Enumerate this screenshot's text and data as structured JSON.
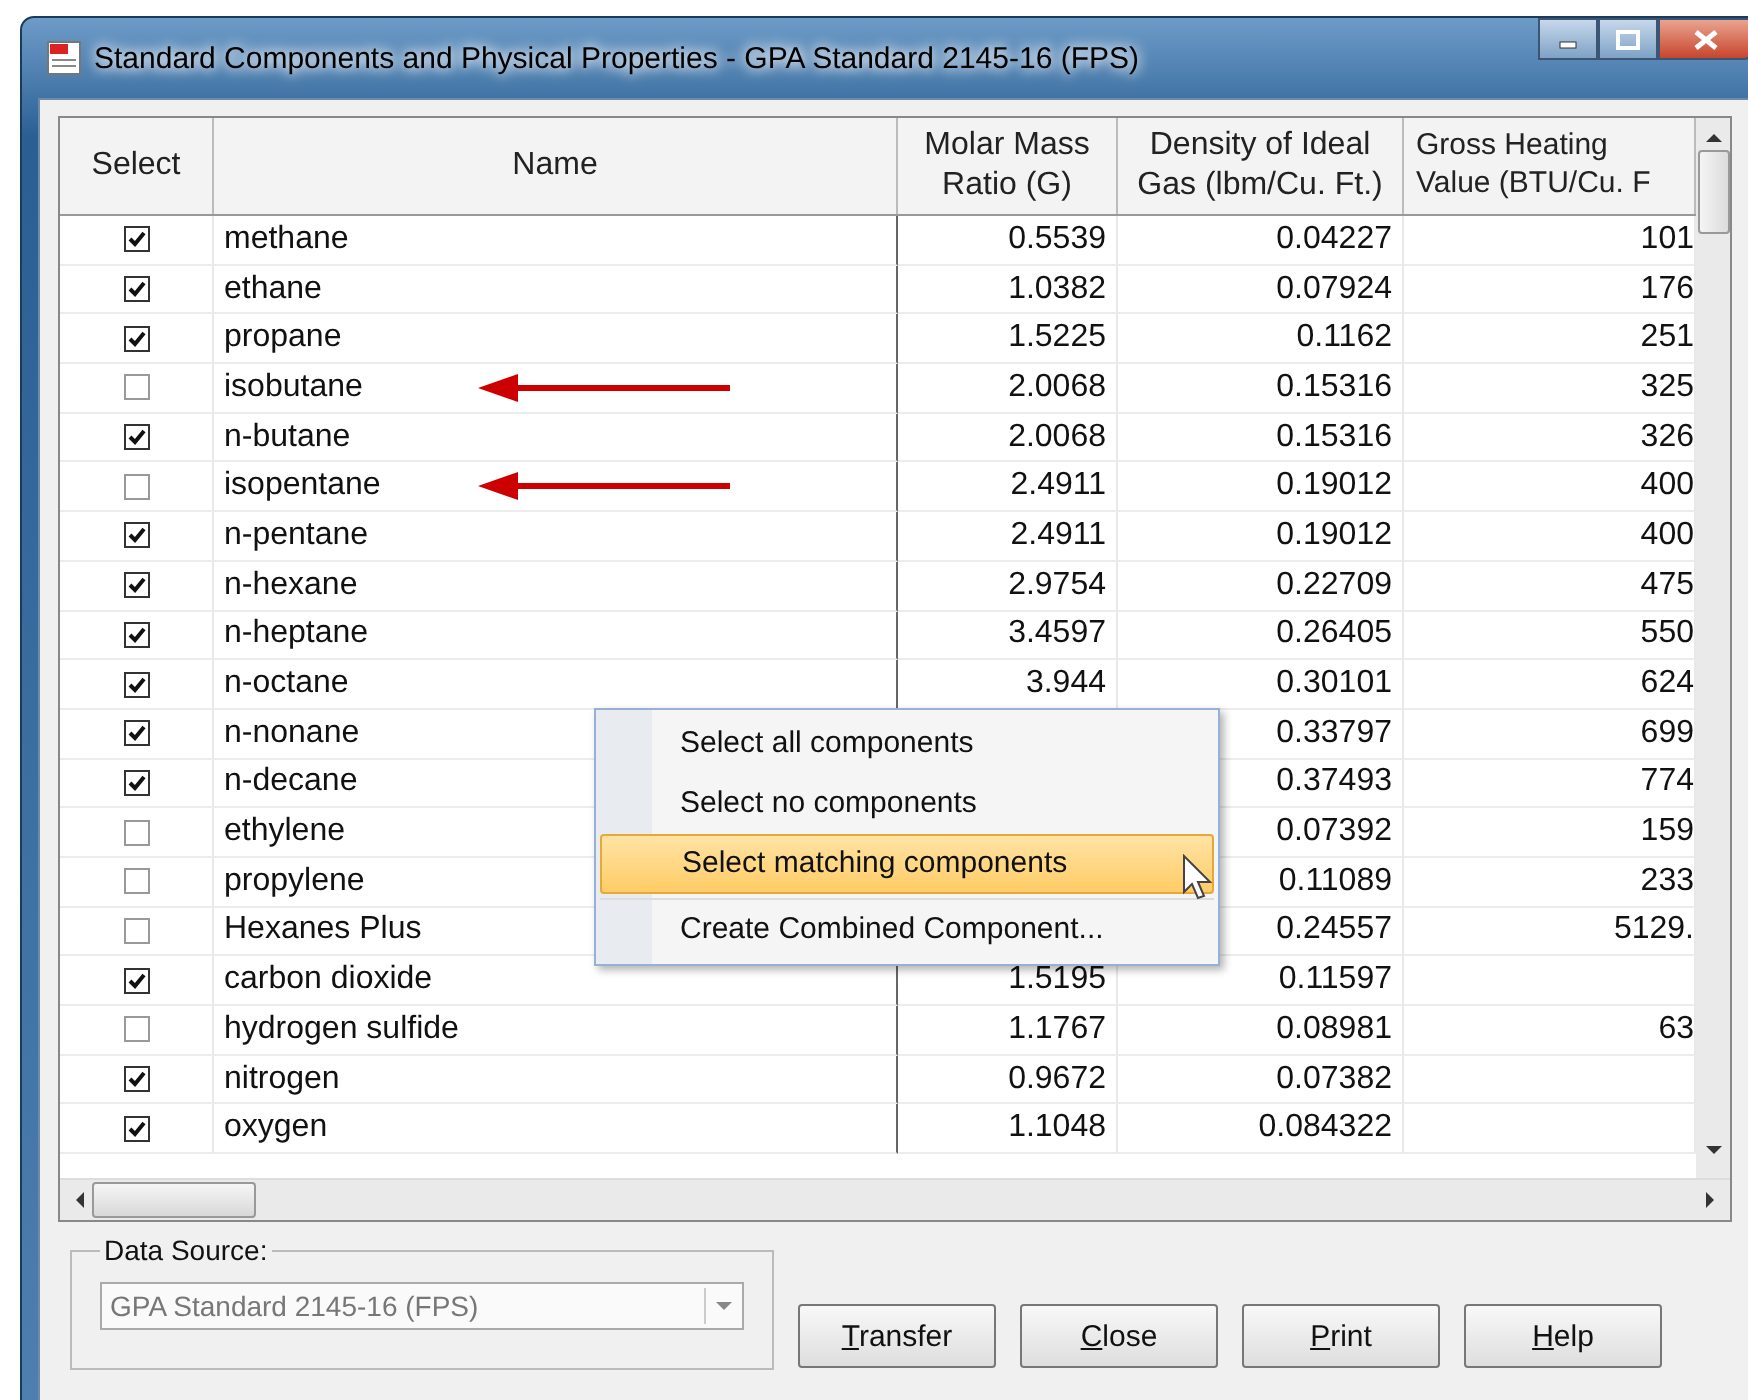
{
  "window": {
    "title": "Standard Components and Physical Properties - GPA Standard 2145-16 (FPS)"
  },
  "table": {
    "columns": [
      "Select",
      "Name",
      "Molar Mass Ratio (G)",
      "Density of Ideal Gas (lbm/Cu. Ft.)",
      "Gross Heating Value (BTU/Cu. F"
    ],
    "rows": [
      {
        "checked": true,
        "annotated": false,
        "name": "methane",
        "molar": "0.5539",
        "density": "0.04227",
        "heating": "101"
      },
      {
        "checked": true,
        "annotated": false,
        "name": "ethane",
        "molar": "1.0382",
        "density": "0.07924",
        "heating": "176"
      },
      {
        "checked": true,
        "annotated": false,
        "name": "propane",
        "molar": "1.5225",
        "density": "0.1162",
        "heating": "251"
      },
      {
        "checked": false,
        "annotated": true,
        "name": "isobutane",
        "molar": "2.0068",
        "density": "0.15316",
        "heating": "325"
      },
      {
        "checked": true,
        "annotated": false,
        "name": "n-butane",
        "molar": "2.0068",
        "density": "0.15316",
        "heating": "326"
      },
      {
        "checked": false,
        "annotated": true,
        "name": "isopentane",
        "molar": "2.4911",
        "density": "0.19012",
        "heating": "400"
      },
      {
        "checked": true,
        "annotated": false,
        "name": "n-pentane",
        "molar": "2.4911",
        "density": "0.19012",
        "heating": "400"
      },
      {
        "checked": true,
        "annotated": false,
        "name": "n-hexane",
        "molar": "2.9754",
        "density": "0.22709",
        "heating": "475"
      },
      {
        "checked": true,
        "annotated": false,
        "name": "n-heptane",
        "molar": "3.4597",
        "density": "0.26405",
        "heating": "550"
      },
      {
        "checked": true,
        "annotated": false,
        "name": "n-octane",
        "molar": "3.944",
        "density": "0.30101",
        "heating": "624"
      },
      {
        "checked": true,
        "annotated": false,
        "name": "n-nonane",
        "density": "0.33797",
        "heating": "699"
      },
      {
        "checked": true,
        "annotated": false,
        "name": "n-decane",
        "density": "0.37493",
        "heating": "774"
      },
      {
        "checked": false,
        "annotated": false,
        "name": "ethylene",
        "density": "0.07392",
        "heating": "159"
      },
      {
        "checked": false,
        "annotated": false,
        "name": "propylene",
        "density": "0.11089",
        "heating": "233"
      },
      {
        "checked": false,
        "annotated": false,
        "name": "Hexanes Plus",
        "density": "0.24557",
        "heating": "5129."
      },
      {
        "checked": true,
        "annotated": false,
        "name": "carbon dioxide",
        "molar": "1.5195",
        "density": "0.11597"
      },
      {
        "checked": false,
        "annotated": false,
        "name": "hydrogen sulfide",
        "molar": "1.1767",
        "density": "0.08981",
        "heating": "63"
      },
      {
        "checked": true,
        "annotated": false,
        "name": "nitrogen",
        "molar": "0.9672",
        "density": "0.07382"
      },
      {
        "checked": true,
        "annotated": false,
        "name": "oxygen",
        "molar": "1.1048",
        "density": "0.084322"
      }
    ]
  },
  "context_menu": {
    "items": [
      {
        "label": "Select all components",
        "selected": false
      },
      {
        "label": "Select no components",
        "selected": false
      },
      {
        "label": "Select matching components",
        "selected": true
      },
      {
        "label": "Create Combined Component...",
        "selected": false
      }
    ]
  },
  "data_source": {
    "label": "Data Source:",
    "value": "GPA Standard 2145-16 (FPS)",
    "disabled": true
  },
  "buttons": [
    "Transfer",
    "Close",
    "Print",
    "Help"
  ]
}
